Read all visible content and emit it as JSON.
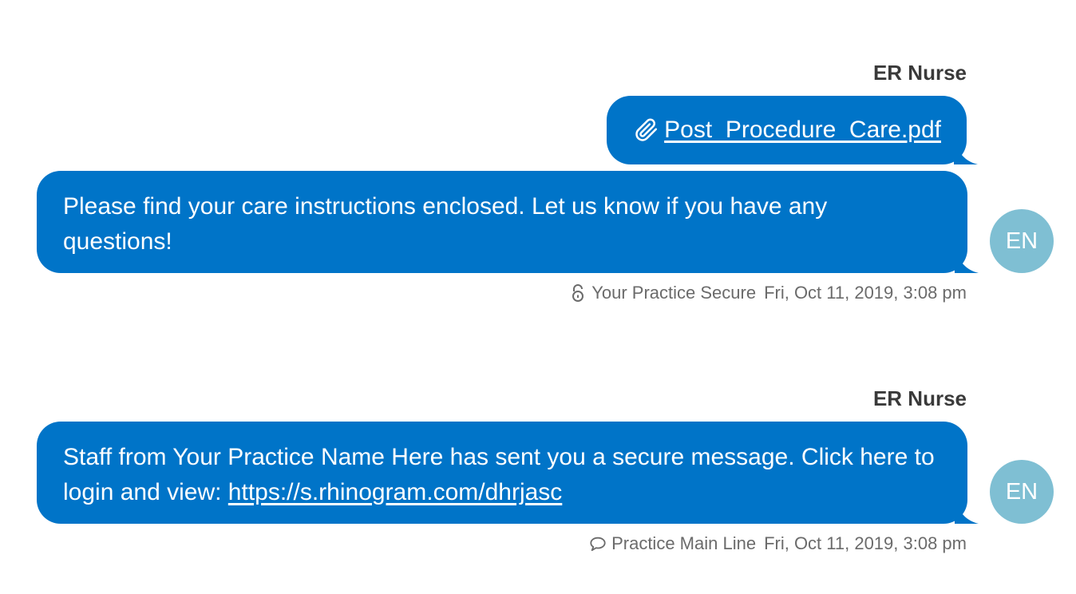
{
  "messages": [
    {
      "sender": "ER Nurse",
      "attachment": "Post_Procedure_Care.pdf",
      "text": "Please find your care instructions enclosed. Let us know if you have any questions!",
      "avatar_initials": "EN",
      "channel_icon": "lock-icon",
      "channel": "Your Practice Secure",
      "timestamp": "Fri, Oct 11, 2019, 3:08 pm"
    },
    {
      "sender": "ER Nurse",
      "text_prefix": "Staff from Your Practice Name Here has sent you a secure message. Click here to login and view: ",
      "link": "https://s.rhinogram.com/dhrjasc",
      "avatar_initials": "EN",
      "channel_icon": "speech-bubble-icon",
      "channel": "Practice Main Line",
      "timestamp": "Fri, Oct 11, 2019, 3:08 pm"
    }
  ],
  "colors": {
    "bubble": "#0074c8",
    "avatar": "#7fbfd3",
    "sender_text": "#3a3a3a",
    "meta_text": "#6b6b6b"
  }
}
